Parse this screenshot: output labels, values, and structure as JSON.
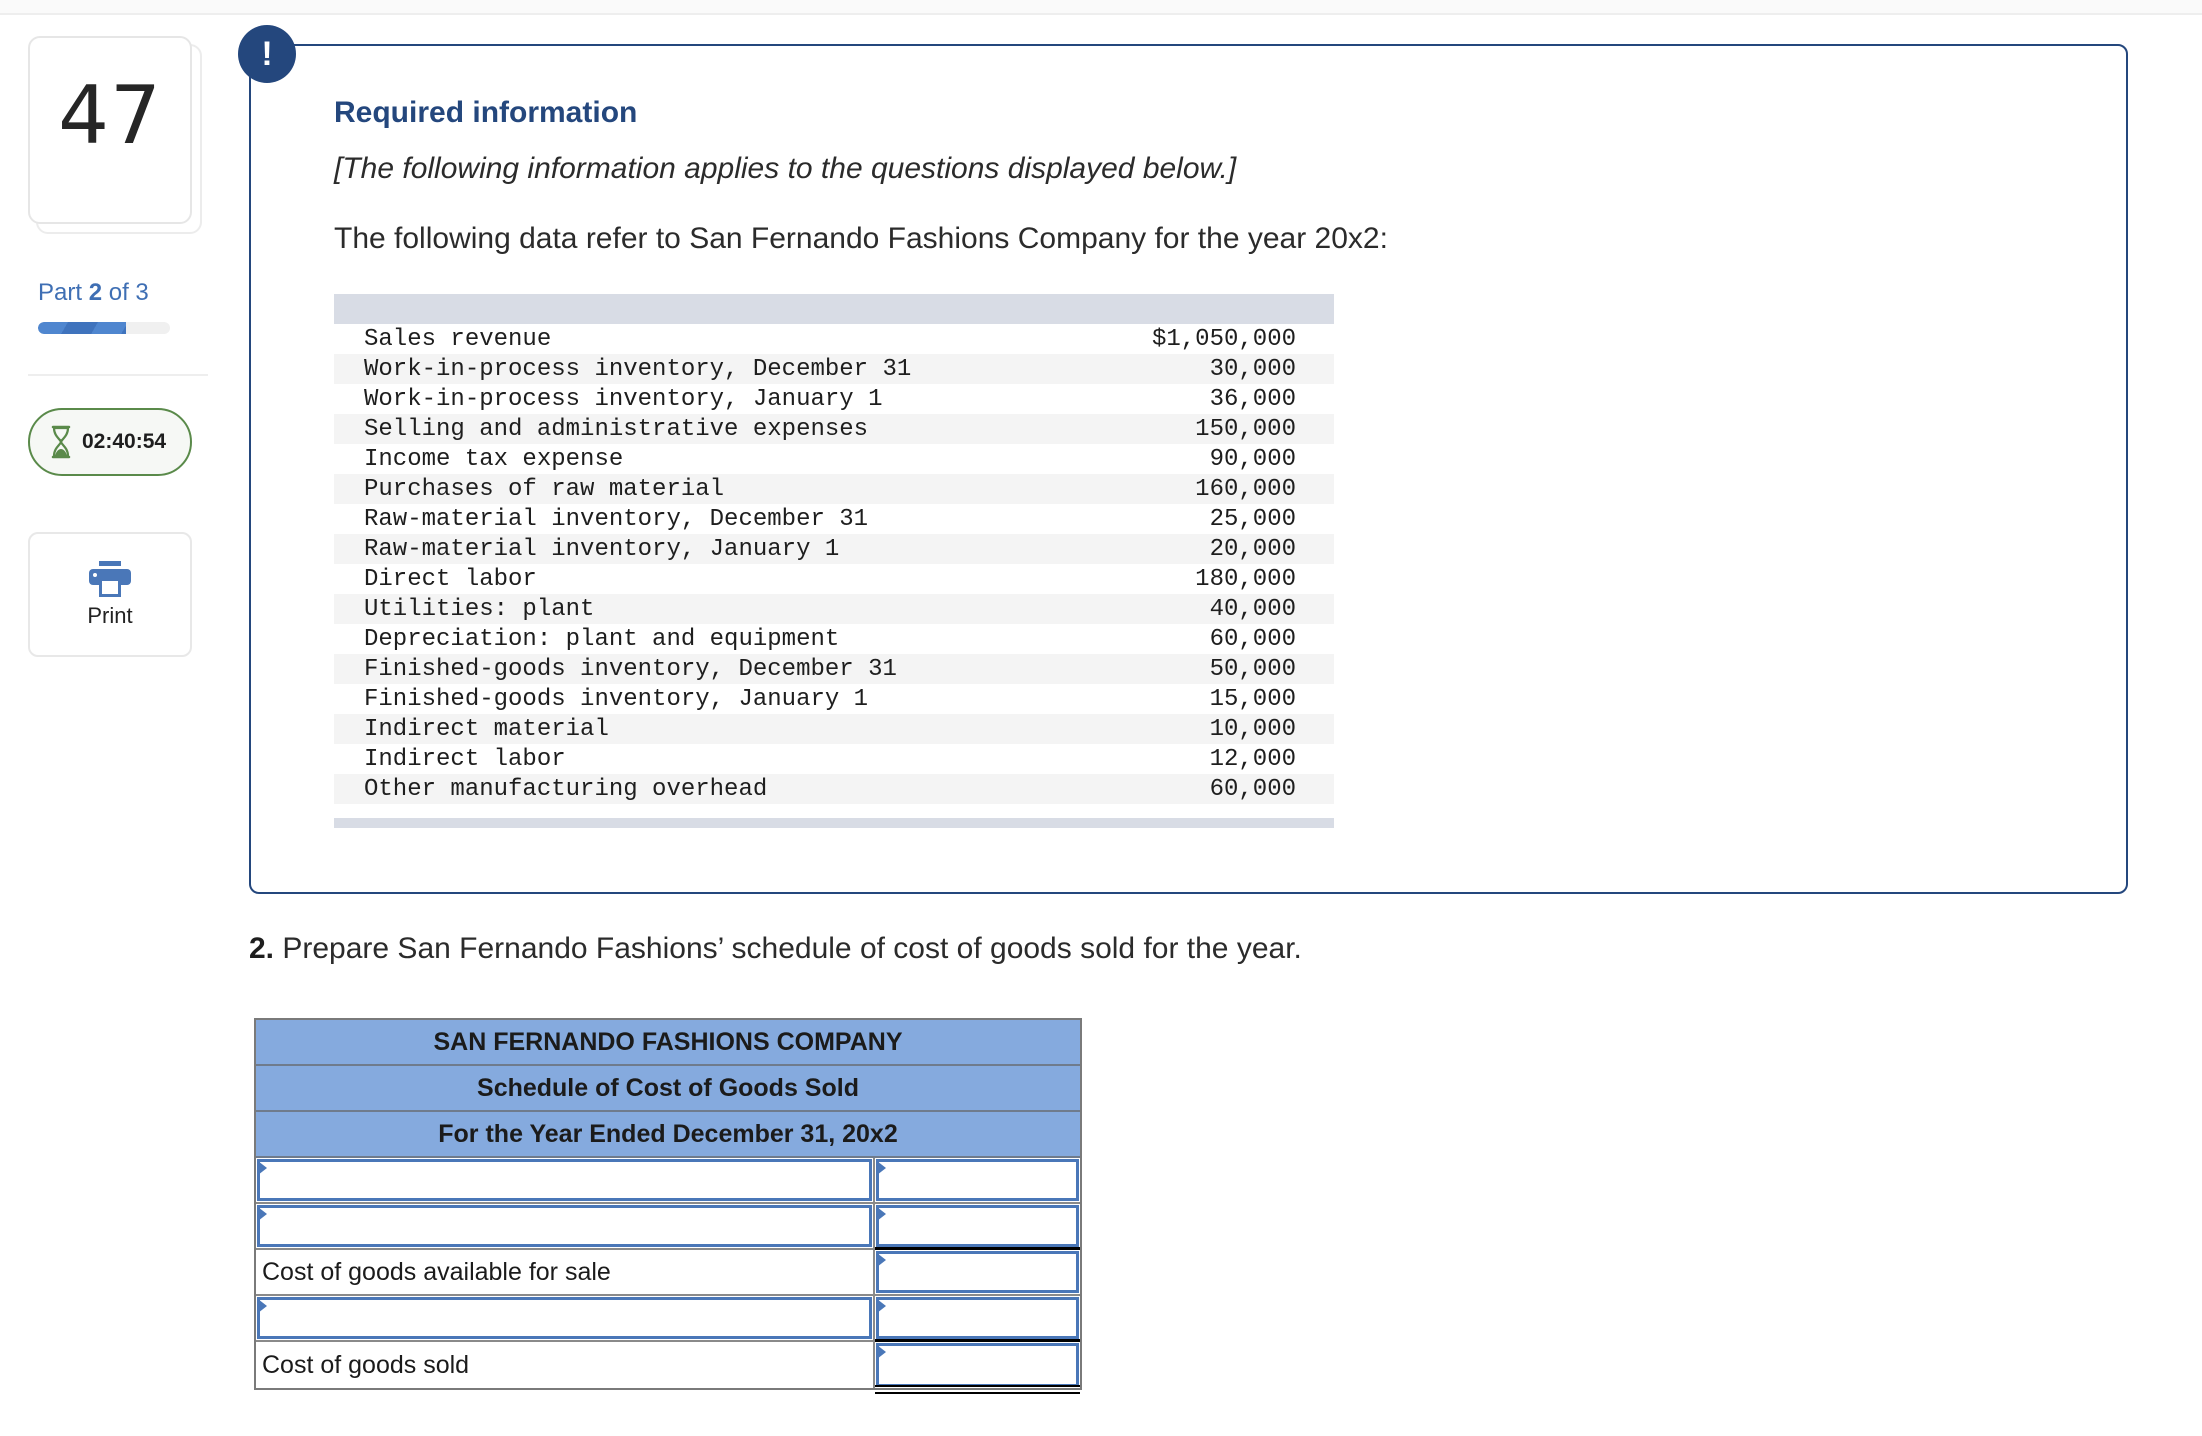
{
  "sidebar": {
    "question_number": "47",
    "part_prefix": "Part",
    "part_current": "2",
    "part_suffix": "of 3",
    "progress_fraction": 0.667,
    "timer": "02:40:54",
    "timer_icon": "hourglass-icon",
    "print_label": "Print",
    "print_icon": "printer-icon"
  },
  "info": {
    "badge": "!",
    "title": "Required information",
    "italic_note": "[The following information applies to the questions displayed below.]",
    "intro": "The following data refer to San Fernando Fashions Company for the year 20x2:",
    "rows": [
      {
        "label": "Sales revenue",
        "value": "$1,050,000"
      },
      {
        "label": "Work-in-process inventory, December 31",
        "value": "30,000"
      },
      {
        "label": "Work-in-process inventory, January 1",
        "value": "36,000"
      },
      {
        "label": "Selling and administrative expenses",
        "value": "150,000"
      },
      {
        "label": "Income tax expense",
        "value": "90,000"
      },
      {
        "label": "Purchases of raw material",
        "value": "160,000"
      },
      {
        "label": "Raw-material inventory, December 31",
        "value": "25,000"
      },
      {
        "label": "Raw-material inventory, January 1",
        "value": "20,000"
      },
      {
        "label": "Direct labor",
        "value": "180,000"
      },
      {
        "label": "Utilities: plant",
        "value": "40,000"
      },
      {
        "label": "Depreciation: plant and equipment",
        "value": "60,000"
      },
      {
        "label": "Finished-goods inventory, December 31",
        "value": "50,000"
      },
      {
        "label": "Finished-goods inventory, January 1",
        "value": "15,000"
      },
      {
        "label": "Indirect material",
        "value": "10,000"
      },
      {
        "label": "Indirect labor",
        "value": "12,000"
      },
      {
        "label": "Other manufacturing overhead",
        "value": "60,000"
      }
    ]
  },
  "question": {
    "number": "2.",
    "text": " Prepare San Fernando Fashions’ schedule of cost of goods sold for the year."
  },
  "schedule": {
    "headers": [
      "SAN FERNANDO FASHIONS COMPANY",
      "Schedule of Cost of Goods Sold",
      "For the Year Ended December 31, 20x2"
    ],
    "rows": [
      {
        "label": "",
        "label_editable": true,
        "amount": ""
      },
      {
        "label": "",
        "label_editable": true,
        "amount": ""
      },
      {
        "label": "Cost of goods available for sale",
        "label_editable": false,
        "amount": ""
      },
      {
        "label": "",
        "label_editable": true,
        "amount": ""
      },
      {
        "label": "Cost of goods sold",
        "label_editable": false,
        "amount": ""
      }
    ]
  },
  "colors": {
    "accent_navy": "#24477d",
    "part_blue": "#3f6fb4",
    "timer_green": "#5a8a4a",
    "schedule_header": "#85aade",
    "input_border": "#4a77b8"
  }
}
